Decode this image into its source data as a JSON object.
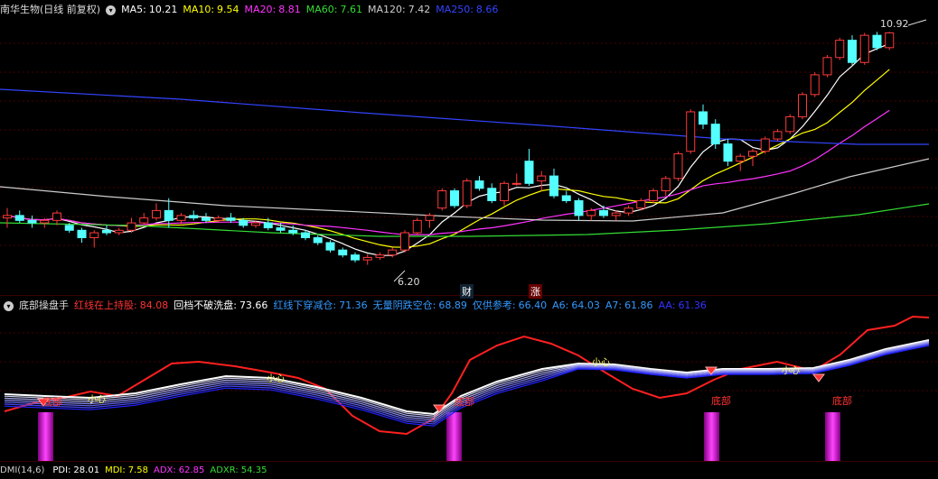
{
  "top_panel": {
    "title": "南华生物(日线 前复权)",
    "ma": [
      {
        "label": "MA5:",
        "value": "10.21",
        "color": "#ffffff"
      },
      {
        "label": "MA10:",
        "value": "9.54",
        "color": "#ffff00"
      },
      {
        "label": "MA20:",
        "value": "8.81",
        "color": "#ff33ff"
      },
      {
        "label": "MA60:",
        "value": "7.61",
        "color": "#33dd33"
      },
      {
        "label": "MA120:",
        "value": "7.42",
        "color": "#cccccc"
      },
      {
        "label": "MA250:",
        "value": "8.66",
        "color": "#3344ff"
      }
    ],
    "high_label": "10.92",
    "low_label": "6.20",
    "marker_cai": "财",
    "marker_zhang": "涨"
  },
  "mid_panel": {
    "title": "底部操盘手",
    "items": [
      {
        "label": "红线在上持股:",
        "value": "84.08",
        "color": "#ff3333"
      },
      {
        "label": "回档不破洗盘:",
        "value": "73.66",
        "color": "#ffffff"
      },
      {
        "label": "红线下穿减仓:",
        "value": "71.36",
        "color": "#3399ff"
      },
      {
        "label": "无量阴跌空仓:",
        "value": "68.89",
        "color": "#3399ff"
      },
      {
        "label": "仅供参考:",
        "value": "66.40",
        "color": "#3399ff"
      },
      {
        "label": "A6:",
        "value": "64.03",
        "color": "#3399ff"
      },
      {
        "label": "A7:",
        "value": "61.86",
        "color": "#3399ff"
      },
      {
        "label": "AA:",
        "value": "61.36",
        "color": "#3333ff"
      }
    ],
    "signal_bottom": "底部",
    "signal_buy": "小心"
  },
  "bottom_panel": {
    "items": [
      {
        "label": "DMI(14,6)",
        "value": "",
        "color": "#cccccc"
      },
      {
        "label": "PDI:",
        "value": "28.01",
        "color": "#ffffff"
      },
      {
        "label": "MDI:",
        "value": "7.58",
        "color": "#ffff00"
      },
      {
        "label": "ADX:",
        "value": "62.85",
        "color": "#ff33ff"
      },
      {
        "label": "ADXR:",
        "value": "54.35",
        "color": "#33dd33"
      }
    ]
  },
  "colors": {
    "up": "#ff3b3b",
    "down": "#54ffff",
    "bg": "#000000"
  },
  "chart_data": {
    "type": "candlestick",
    "ylim": [
      5.9,
      11.2
    ],
    "candles": [
      [
        7.15,
        7.35,
        6.95,
        7.2
      ],
      [
        7.2,
        7.3,
        7.05,
        7.1
      ],
      [
        7.1,
        7.2,
        6.95,
        7.05
      ],
      [
        7.05,
        7.15,
        6.95,
        7.1
      ],
      [
        7.1,
        7.3,
        7.0,
        7.25
      ],
      [
        7.0,
        7.05,
        6.85,
        6.9
      ],
      [
        6.9,
        6.95,
        6.65,
        6.75
      ],
      [
        6.75,
        6.9,
        6.55,
        6.85
      ],
      [
        6.9,
        7.0,
        6.8,
        6.85
      ],
      [
        6.85,
        6.95,
        6.8,
        6.9
      ],
      [
        6.9,
        7.15,
        6.85,
        7.05
      ],
      [
        7.05,
        7.25,
        7.0,
        7.15
      ],
      [
        7.15,
        7.45,
        7.1,
        7.3
      ],
      [
        7.3,
        7.55,
        6.95,
        7.1
      ],
      [
        7.1,
        7.25,
        7.0,
        7.2
      ],
      [
        7.2,
        7.3,
        7.1,
        7.15
      ],
      [
        7.15,
        7.25,
        7.05,
        7.1
      ],
      [
        7.1,
        7.2,
        7.05,
        7.15
      ],
      [
        7.15,
        7.25,
        7.05,
        7.1
      ],
      [
        7.1,
        7.15,
        6.95,
        7.0
      ],
      [
        7.0,
        7.1,
        6.95,
        7.05
      ],
      [
        7.05,
        7.15,
        6.9,
        6.95
      ],
      [
        6.95,
        7.05,
        6.85,
        6.9
      ],
      [
        6.9,
        7.0,
        6.8,
        6.85
      ],
      [
        6.85,
        6.9,
        6.7,
        6.75
      ],
      [
        6.75,
        6.8,
        6.6,
        6.65
      ],
      [
        6.65,
        6.7,
        6.45,
        6.5
      ],
      [
        6.5,
        6.55,
        6.35,
        6.4
      ],
      [
        6.4,
        6.45,
        6.25,
        6.3
      ],
      [
        6.3,
        6.42,
        6.2,
        6.35
      ],
      [
        6.35,
        6.45,
        6.3,
        6.4
      ],
      [
        6.4,
        6.55,
        6.35,
        6.5
      ],
      [
        6.5,
        6.9,
        6.45,
        6.85
      ],
      [
        6.85,
        7.15,
        6.8,
        7.1
      ],
      [
        7.1,
        7.25,
        6.95,
        7.2
      ],
      [
        7.35,
        7.75,
        7.3,
        7.7
      ],
      [
        7.7,
        7.75,
        7.35,
        7.4
      ],
      [
        7.4,
        7.95,
        7.35,
        7.9
      ],
      [
        7.9,
        8.0,
        7.7,
        7.75
      ],
      [
        7.75,
        7.85,
        7.45,
        7.5
      ],
      [
        7.5,
        7.9,
        7.4,
        7.85
      ],
      [
        7.85,
        8.05,
        7.8,
        7.85
      ],
      [
        8.3,
        8.55,
        7.8,
        7.85
      ],
      [
        7.9,
        8.1,
        7.7,
        8.0
      ],
      [
        8.0,
        8.15,
        7.55,
        7.6
      ],
      [
        7.6,
        7.7,
        7.45,
        7.5
      ],
      [
        7.5,
        7.55,
        7.1,
        7.2
      ],
      [
        7.2,
        7.35,
        7.1,
        7.3
      ],
      [
        7.3,
        7.4,
        7.15,
        7.2
      ],
      [
        7.2,
        7.3,
        7.1,
        7.25
      ],
      [
        7.25,
        7.4,
        7.2,
        7.35
      ],
      [
        7.35,
        7.55,
        7.3,
        7.5
      ],
      [
        7.5,
        7.75,
        7.45,
        7.7
      ],
      [
        7.7,
        8.0,
        7.6,
        7.95
      ],
      [
        7.95,
        8.5,
        7.9,
        8.45
      ],
      [
        8.5,
        9.35,
        8.45,
        9.3
      ],
      [
        9.3,
        9.45,
        8.95,
        9.05
      ],
      [
        9.05,
        9.15,
        8.55,
        8.65
      ],
      [
        8.65,
        8.75,
        8.2,
        8.3
      ],
      [
        8.3,
        8.45,
        8.1,
        8.4
      ],
      [
        8.4,
        8.55,
        8.2,
        8.5
      ],
      [
        8.5,
        8.8,
        8.45,
        8.75
      ],
      [
        8.75,
        8.95,
        8.7,
        8.9
      ],
      [
        8.9,
        9.25,
        8.85,
        9.2
      ],
      [
        9.2,
        9.7,
        9.15,
        9.65
      ],
      [
        9.65,
        10.1,
        9.6,
        10.05
      ],
      [
        10.05,
        10.45,
        10.0,
        10.4
      ],
      [
        10.4,
        10.8,
        10.35,
        10.75
      ],
      [
        10.75,
        10.85,
        10.25,
        10.3
      ],
      [
        10.3,
        10.9,
        10.25,
        10.85
      ],
      [
        10.85,
        10.92,
        10.55,
        10.6
      ],
      [
        10.6,
        10.92,
        10.55,
        10.9
      ]
    ]
  }
}
